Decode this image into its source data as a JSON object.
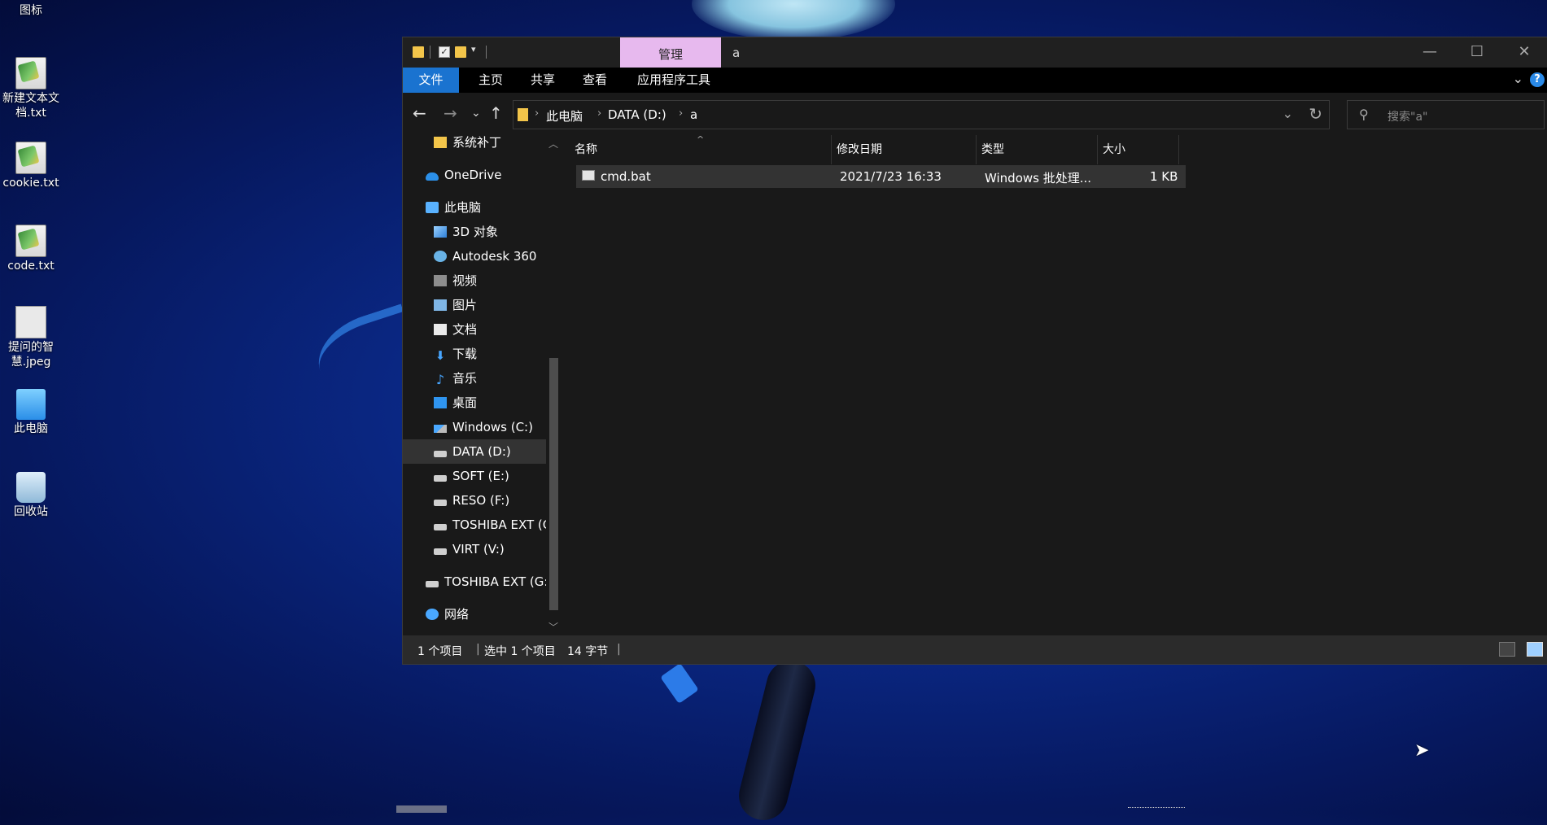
{
  "desktop": {
    "icons": [
      {
        "label": "图标",
        "icon": "folder-icon"
      },
      {
        "label": "新建文本文档.txt",
        "icon": "notepad-file-icon"
      },
      {
        "label": "cookie.txt",
        "icon": "notepad-file-icon"
      },
      {
        "label": "code.txt",
        "icon": "notepad-file-icon"
      },
      {
        "label": "提问的智慧.jpeg",
        "icon": "image-file-icon"
      },
      {
        "label": "此电脑",
        "icon": "this-pc-icon"
      },
      {
        "label": "回收站",
        "icon": "recycle-bin-icon"
      }
    ]
  },
  "window": {
    "title": "a",
    "context_tab": "管理",
    "caption": {
      "minimize": "—",
      "maximize": "☐",
      "close": "✕"
    }
  },
  "ribbon": {
    "tabs": [
      "文件",
      "主页",
      "共享",
      "查看",
      "应用程序工具"
    ],
    "expand": "⌄",
    "help": "?"
  },
  "navbar": {
    "back": "←",
    "forward": "→",
    "recent": "⌄",
    "up": "↑",
    "breadcrumb": [
      "此电脑",
      "DATA (D:)",
      "a"
    ],
    "search_placeholder": "搜索\"a\""
  },
  "tree": [
    {
      "label": "系统补丁",
      "icon": "folder-icon"
    },
    {
      "label": "OneDrive",
      "icon": "onedrive-icon"
    },
    {
      "label": "此电脑",
      "icon": "this-pc-icon"
    },
    {
      "label": "3D 对象",
      "icon": "3d-objects-icon"
    },
    {
      "label": "Autodesk 360",
      "icon": "autodesk-icon"
    },
    {
      "label": "视频",
      "icon": "videos-icon"
    },
    {
      "label": "图片",
      "icon": "pictures-icon"
    },
    {
      "label": "文档",
      "icon": "documents-icon"
    },
    {
      "label": "下载",
      "icon": "downloads-icon"
    },
    {
      "label": "音乐",
      "icon": "music-icon"
    },
    {
      "label": "桌面",
      "icon": "desktop-icon"
    },
    {
      "label": "Windows (C:)",
      "icon": "windows-drive-icon"
    },
    {
      "label": "DATA (D:)",
      "icon": "drive-icon"
    },
    {
      "label": "SOFT (E:)",
      "icon": "drive-icon"
    },
    {
      "label": "RESO (F:)",
      "icon": "drive-icon"
    },
    {
      "label": "TOSHIBA EXT (G:)",
      "icon": "drive-icon"
    },
    {
      "label": "VIRT (V:)",
      "icon": "drive-icon"
    },
    {
      "label": "TOSHIBA EXT (G:)",
      "icon": "drive-icon"
    },
    {
      "label": "网络",
      "icon": "network-icon"
    }
  ],
  "columns": {
    "name": "名称",
    "modified": "修改日期",
    "type": "类型",
    "size": "大小"
  },
  "files": [
    {
      "name": "cmd.bat",
      "modified": "2021/7/23 16:33",
      "type": "Windows 批处理...",
      "size": "1 KB",
      "icon": "batch-file-icon"
    }
  ],
  "status": {
    "count": "1 个项目",
    "selected": "选中 1 个项目",
    "bytes": "14 字节",
    "separator": "|"
  }
}
